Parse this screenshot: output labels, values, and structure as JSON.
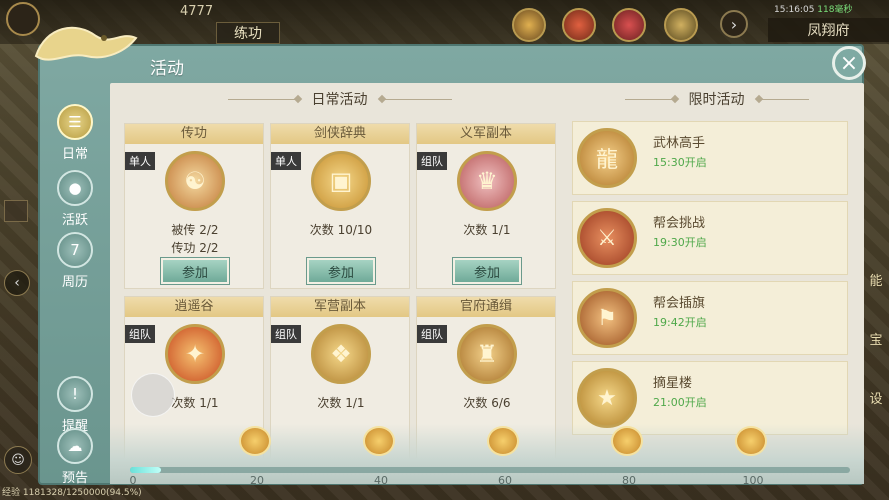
{
  "hud": {
    "power": "4777",
    "practice_label": "练功",
    "clock": "15:16:05",
    "signal": "118毫秒",
    "map_name": "凤翔府",
    "exp_text": "经验 1181328/1250000(94.5%)",
    "right_labels": [
      "能",
      "宝",
      "设"
    ]
  },
  "panel": {
    "title": "活动",
    "close_icon": "×"
  },
  "side_tabs": [
    {
      "label": "日常",
      "icon": "daily-icon",
      "active": true
    },
    {
      "label": "活跃",
      "icon": "gourd-icon",
      "active": false
    },
    {
      "label": "周历",
      "icon": "calendar-icon",
      "glyph": "7",
      "active": false
    },
    {
      "label": "提醒",
      "icon": "reminder-icon",
      "active": false
    },
    {
      "label": "预告",
      "icon": "cloud-icon",
      "active": false
    }
  ],
  "daily": {
    "heading": "日常活动",
    "cards": [
      {
        "title": "传功",
        "tag": "单人",
        "stats": [
          "被传 2/2",
          "传功 2/2"
        ],
        "button": "参加"
      },
      {
        "title": "剑侠辞典",
        "tag": "单人",
        "stats": [
          "次数 10/10"
        ],
        "button": "参加"
      },
      {
        "title": "义军副本",
        "tag": "组队",
        "stats": [
          "次数 1/1"
        ],
        "button": "参加"
      },
      {
        "title": "逍遥谷",
        "tag": "组队",
        "stats": [
          "次数 1/1"
        ]
      },
      {
        "title": "军营副本",
        "tag": "组队",
        "stats": [
          "次数 1/1"
        ]
      },
      {
        "title": "官府通缉",
        "tag": "组队",
        "stats": [
          "次数 6/6"
        ]
      }
    ]
  },
  "limited": {
    "heading": "限时活动",
    "items": [
      {
        "name": "武林高手",
        "time": "15:30开启"
      },
      {
        "name": "帮会挑战",
        "time": "19:30开启"
      },
      {
        "name": "帮会插旗",
        "time": "19:42开启"
      },
      {
        "name": "摘星楼",
        "time": "21:00开启"
      }
    ]
  },
  "progress": {
    "value": 5,
    "max": 100,
    "ticks": [
      "0",
      "20",
      "40",
      "60",
      "80",
      "100"
    ],
    "fill_color": "#6ae0d8"
  }
}
